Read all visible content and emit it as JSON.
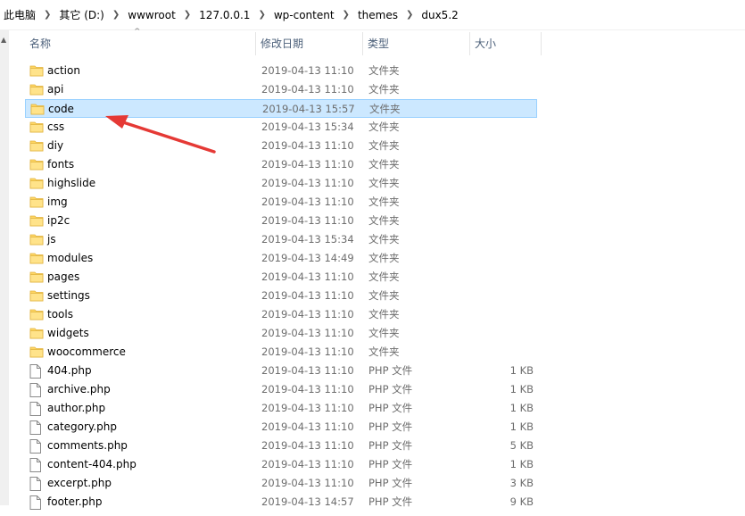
{
  "breadcrumb": [
    {
      "label": "此电脑"
    },
    {
      "label": "其它 (D:)"
    },
    {
      "label": "wwwroot"
    },
    {
      "label": "127.0.0.1"
    },
    {
      "label": "wp-content"
    },
    {
      "label": "themes"
    },
    {
      "label": "dux5.2"
    }
  ],
  "columns": {
    "name": "名称",
    "date": "修改日期",
    "type": "类型",
    "size": "大小"
  },
  "colors": {
    "selected_bg": "#cce8ff",
    "selected_border": "#99d1ff",
    "folder": "#ffd766",
    "arrow": "#e53935"
  },
  "files": [
    {
      "name": "action",
      "date": "2019-04-13 11:10",
      "type": "文件夹",
      "size": "",
      "icon": "folder-icon"
    },
    {
      "name": "api",
      "date": "2019-04-13 11:10",
      "type": "文件夹",
      "size": "",
      "icon": "folder-icon"
    },
    {
      "name": "code",
      "date": "2019-04-13 15:57",
      "type": "文件夹",
      "size": "",
      "icon": "folder-icon",
      "selected": true
    },
    {
      "name": "css",
      "date": "2019-04-13 15:34",
      "type": "文件夹",
      "size": "",
      "icon": "folder-icon"
    },
    {
      "name": "diy",
      "date": "2019-04-13 11:10",
      "type": "文件夹",
      "size": "",
      "icon": "folder-icon"
    },
    {
      "name": "fonts",
      "date": "2019-04-13 11:10",
      "type": "文件夹",
      "size": "",
      "icon": "folder-icon"
    },
    {
      "name": "highslide",
      "date": "2019-04-13 11:10",
      "type": "文件夹",
      "size": "",
      "icon": "folder-icon"
    },
    {
      "name": "img",
      "date": "2019-04-13 11:10",
      "type": "文件夹",
      "size": "",
      "icon": "folder-icon"
    },
    {
      "name": "ip2c",
      "date": "2019-04-13 11:10",
      "type": "文件夹",
      "size": "",
      "icon": "folder-icon"
    },
    {
      "name": "js",
      "date": "2019-04-13 15:34",
      "type": "文件夹",
      "size": "",
      "icon": "folder-icon"
    },
    {
      "name": "modules",
      "date": "2019-04-13 14:49",
      "type": "文件夹",
      "size": "",
      "icon": "folder-icon"
    },
    {
      "name": "pages",
      "date": "2019-04-13 11:10",
      "type": "文件夹",
      "size": "",
      "icon": "folder-icon"
    },
    {
      "name": "settings",
      "date": "2019-04-13 11:10",
      "type": "文件夹",
      "size": "",
      "icon": "folder-icon"
    },
    {
      "name": "tools",
      "date": "2019-04-13 11:10",
      "type": "文件夹",
      "size": "",
      "icon": "folder-icon"
    },
    {
      "name": "widgets",
      "date": "2019-04-13 11:10",
      "type": "文件夹",
      "size": "",
      "icon": "folder-icon"
    },
    {
      "name": "woocommerce",
      "date": "2019-04-13 11:10",
      "type": "文件夹",
      "size": "",
      "icon": "folder-icon"
    },
    {
      "name": "404.php",
      "date": "2019-04-13 11:10",
      "type": "PHP 文件",
      "size": "1 KB",
      "icon": "file-icon"
    },
    {
      "name": "archive.php",
      "date": "2019-04-13 11:10",
      "type": "PHP 文件",
      "size": "1 KB",
      "icon": "file-icon"
    },
    {
      "name": "author.php",
      "date": "2019-04-13 11:10",
      "type": "PHP 文件",
      "size": "1 KB",
      "icon": "file-icon"
    },
    {
      "name": "category.php",
      "date": "2019-04-13 11:10",
      "type": "PHP 文件",
      "size": "1 KB",
      "icon": "file-icon"
    },
    {
      "name": "comments.php",
      "date": "2019-04-13 11:10",
      "type": "PHP 文件",
      "size": "5 KB",
      "icon": "file-icon"
    },
    {
      "name": "content-404.php",
      "date": "2019-04-13 11:10",
      "type": "PHP 文件",
      "size": "1 KB",
      "icon": "file-icon"
    },
    {
      "name": "excerpt.php",
      "date": "2019-04-13 11:10",
      "type": "PHP 文件",
      "size": "3 KB",
      "icon": "file-icon"
    },
    {
      "name": "footer.php",
      "date": "2019-04-13 14:57",
      "type": "PHP 文件",
      "size": "9 KB",
      "icon": "file-icon"
    }
  ]
}
